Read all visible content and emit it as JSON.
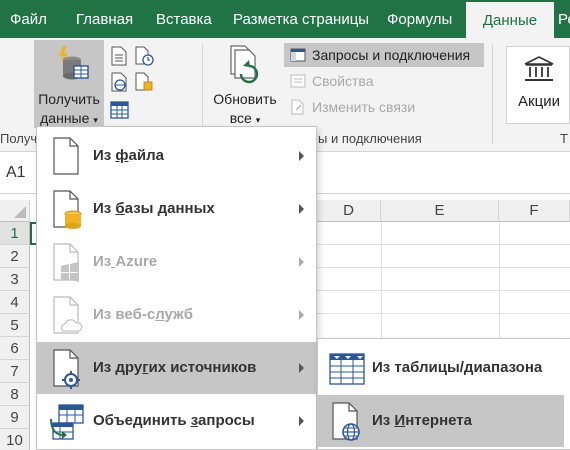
{
  "ribbon": {
    "tabs": [
      "Файл",
      "Главная",
      "Вставка",
      "Разметка страницы",
      "Формулы",
      "Данные",
      "Ре"
    ],
    "active_tab": "Данные",
    "get_data": {
      "line1": "Получить",
      "line2": "данные"
    },
    "refresh_all": {
      "line1": "Обновить",
      "line2": "все"
    },
    "queries_connections": "Запросы и подключения",
    "properties": "Свойства",
    "edit_links": "Изменить связи",
    "group_get_label": "Получи",
    "group_queries_label": "ы и подключения",
    "stocks": "Акции",
    "t_label": "Т"
  },
  "formula_bar": {
    "name_box": "A1"
  },
  "grid": {
    "columns": [
      "D",
      "E",
      "F"
    ],
    "rows": [
      "1",
      "2",
      "3",
      "4",
      "5",
      "6",
      "7",
      "8",
      "9",
      "10"
    ]
  },
  "menu": {
    "items": [
      {
        "pre": "Из ",
        "ul": "ф",
        "post": "айла"
      },
      {
        "pre": "Из ",
        "ul": "б",
        "post": "азы данных"
      },
      {
        "pre": "Из",
        "ul": " ",
        "post": "Azure"
      },
      {
        "pre": "Из веб-с",
        "ul": "л",
        "post": "ужб"
      },
      {
        "pre": "Из дру",
        "ul": "г",
        "post": "их источников"
      },
      {
        "pre": "Объединить ",
        "ul": "з",
        "post": "апросы"
      }
    ]
  },
  "submenu": {
    "items": [
      {
        "pre": "Из таблицы/диапазона",
        "ul": "",
        "post": ""
      },
      {
        "pre": "Из ",
        "ul": "И",
        "post": "нтернета"
      }
    ]
  },
  "colors": {
    "accent": "#217346",
    "highlight": "#c6c6c6",
    "disabled": "#a8a8a8"
  }
}
